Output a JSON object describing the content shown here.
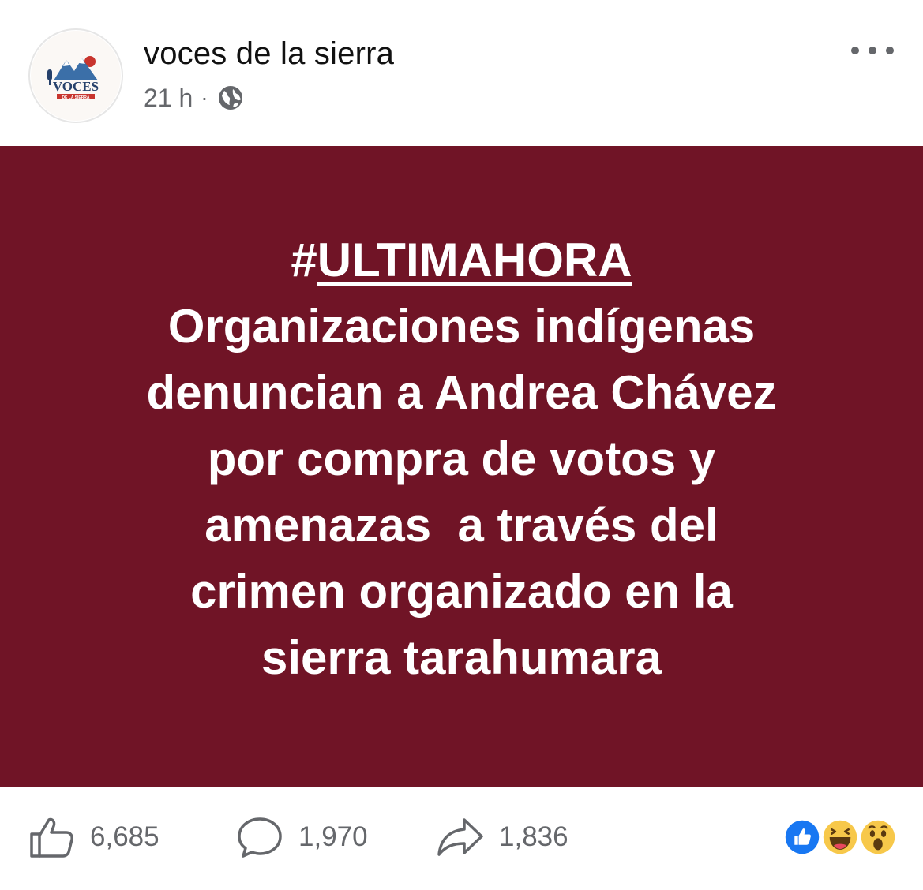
{
  "post": {
    "page_name": "voces de la sierra",
    "time_ago": "21 h",
    "separator": "·",
    "privacy_icon": "globe-icon",
    "more_icon": "more-options-icon",
    "avatar": {
      "logo_text": "VOCES",
      "logo_subtext": "DE LA SIERRA"
    }
  },
  "banner": {
    "background_color": "#701426",
    "text_color": "#ffffff",
    "hashtag_symbol": "#",
    "hashtag_word": "ULTIMAHORA",
    "lines": [
      "Organizaciones indígenas",
      "denuncian a Andrea Chávez",
      "por compra de votos y",
      "amenazas  a través del",
      "crimen organizado en la",
      "sierra tarahumara"
    ]
  },
  "engagement": {
    "likes": "6,685",
    "comments": "1,970",
    "shares": "1,836",
    "like_icon": "thumbs-up-icon",
    "comment_icon": "comment-bubble-icon",
    "share_icon": "share-arrow-icon",
    "reactions": [
      "like-reaction-icon",
      "haha-reaction-icon",
      "wow-reaction-icon"
    ]
  },
  "colors": {
    "secondary_text": "#65676b",
    "like_blue": "#1877f2",
    "emoji_yellow": "#f7c84a"
  }
}
